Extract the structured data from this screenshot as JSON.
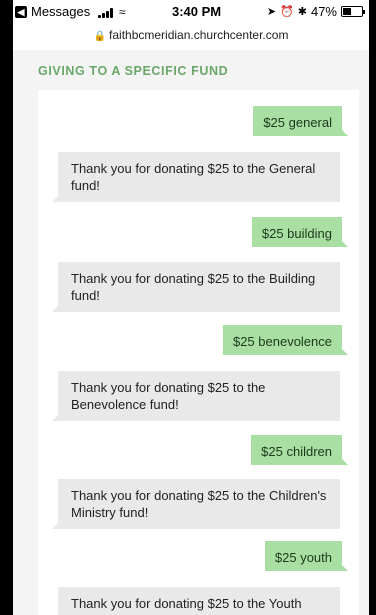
{
  "status_bar": {
    "back_app": "Messages",
    "time": "3:40 PM",
    "battery": "47%",
    "battery_level": 0.47,
    "url": "faithbcmeridian.churchcenter.com"
  },
  "section": {
    "heading": "GIVING TO A SPECIFIC FUND"
  },
  "messages": [
    {
      "type": "sent",
      "text": "$25 general"
    },
    {
      "type": "received",
      "text": "Thank you for donating $25 to the General fund!"
    },
    {
      "type": "sent",
      "text": "$25 building"
    },
    {
      "type": "received",
      "text": "Thank you for donating $25 to the Building fund!"
    },
    {
      "type": "sent",
      "text": "$25 benevolence"
    },
    {
      "type": "received",
      "text": "Thank you for donating $25 to the Benevolence fund!"
    },
    {
      "type": "sent",
      "text": "$25 children"
    },
    {
      "type": "received",
      "text": "Thank you for donating $25 to the Children's Ministry fund!"
    },
    {
      "type": "sent",
      "text": "$25 youth"
    },
    {
      "type": "received",
      "text": "Thank you for donating $25 to the Youth"
    }
  ],
  "icons": {
    "back": "back-arrow-icon",
    "signal": "cellular-signal-icon",
    "wifi": "wifi-icon",
    "location": "location-arrow-icon",
    "alarm": "alarm-icon",
    "bluetooth": "bluetooth-icon",
    "battery": "battery-icon",
    "lock": "lock-icon"
  },
  "colors": {
    "accent_heading": "#6aa86a",
    "sent_bubble": "#a9dfa2",
    "received_bubble": "#e9e9e9"
  }
}
